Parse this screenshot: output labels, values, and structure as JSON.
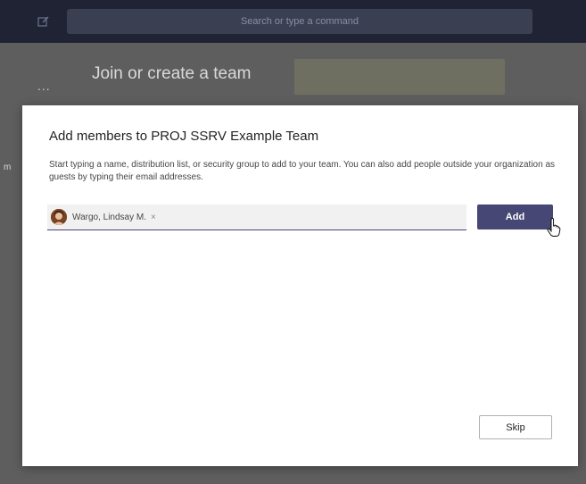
{
  "header": {
    "search_placeholder": "Search or type a command",
    "compose_icon": "compose-icon"
  },
  "background": {
    "more_label": "...",
    "page_title": "Join or create a team",
    "edge_text": "m"
  },
  "dialog": {
    "title": "Add members to PROJ SSRV Example Team",
    "description": "Start typing a name, distribution list, or security group to add to your team. You can also add people outside your organization as guests by typing their email addresses.",
    "selected_people": [
      {
        "name": "Wargo, Lindsay M.",
        "remove_label": "×",
        "avatar_icon": "person-avatar"
      }
    ],
    "add_label": "Add",
    "skip_label": "Skip"
  },
  "colors": {
    "topbar": "#1f2333",
    "accent": "#464775",
    "backdrop": "#5e5e5e"
  }
}
